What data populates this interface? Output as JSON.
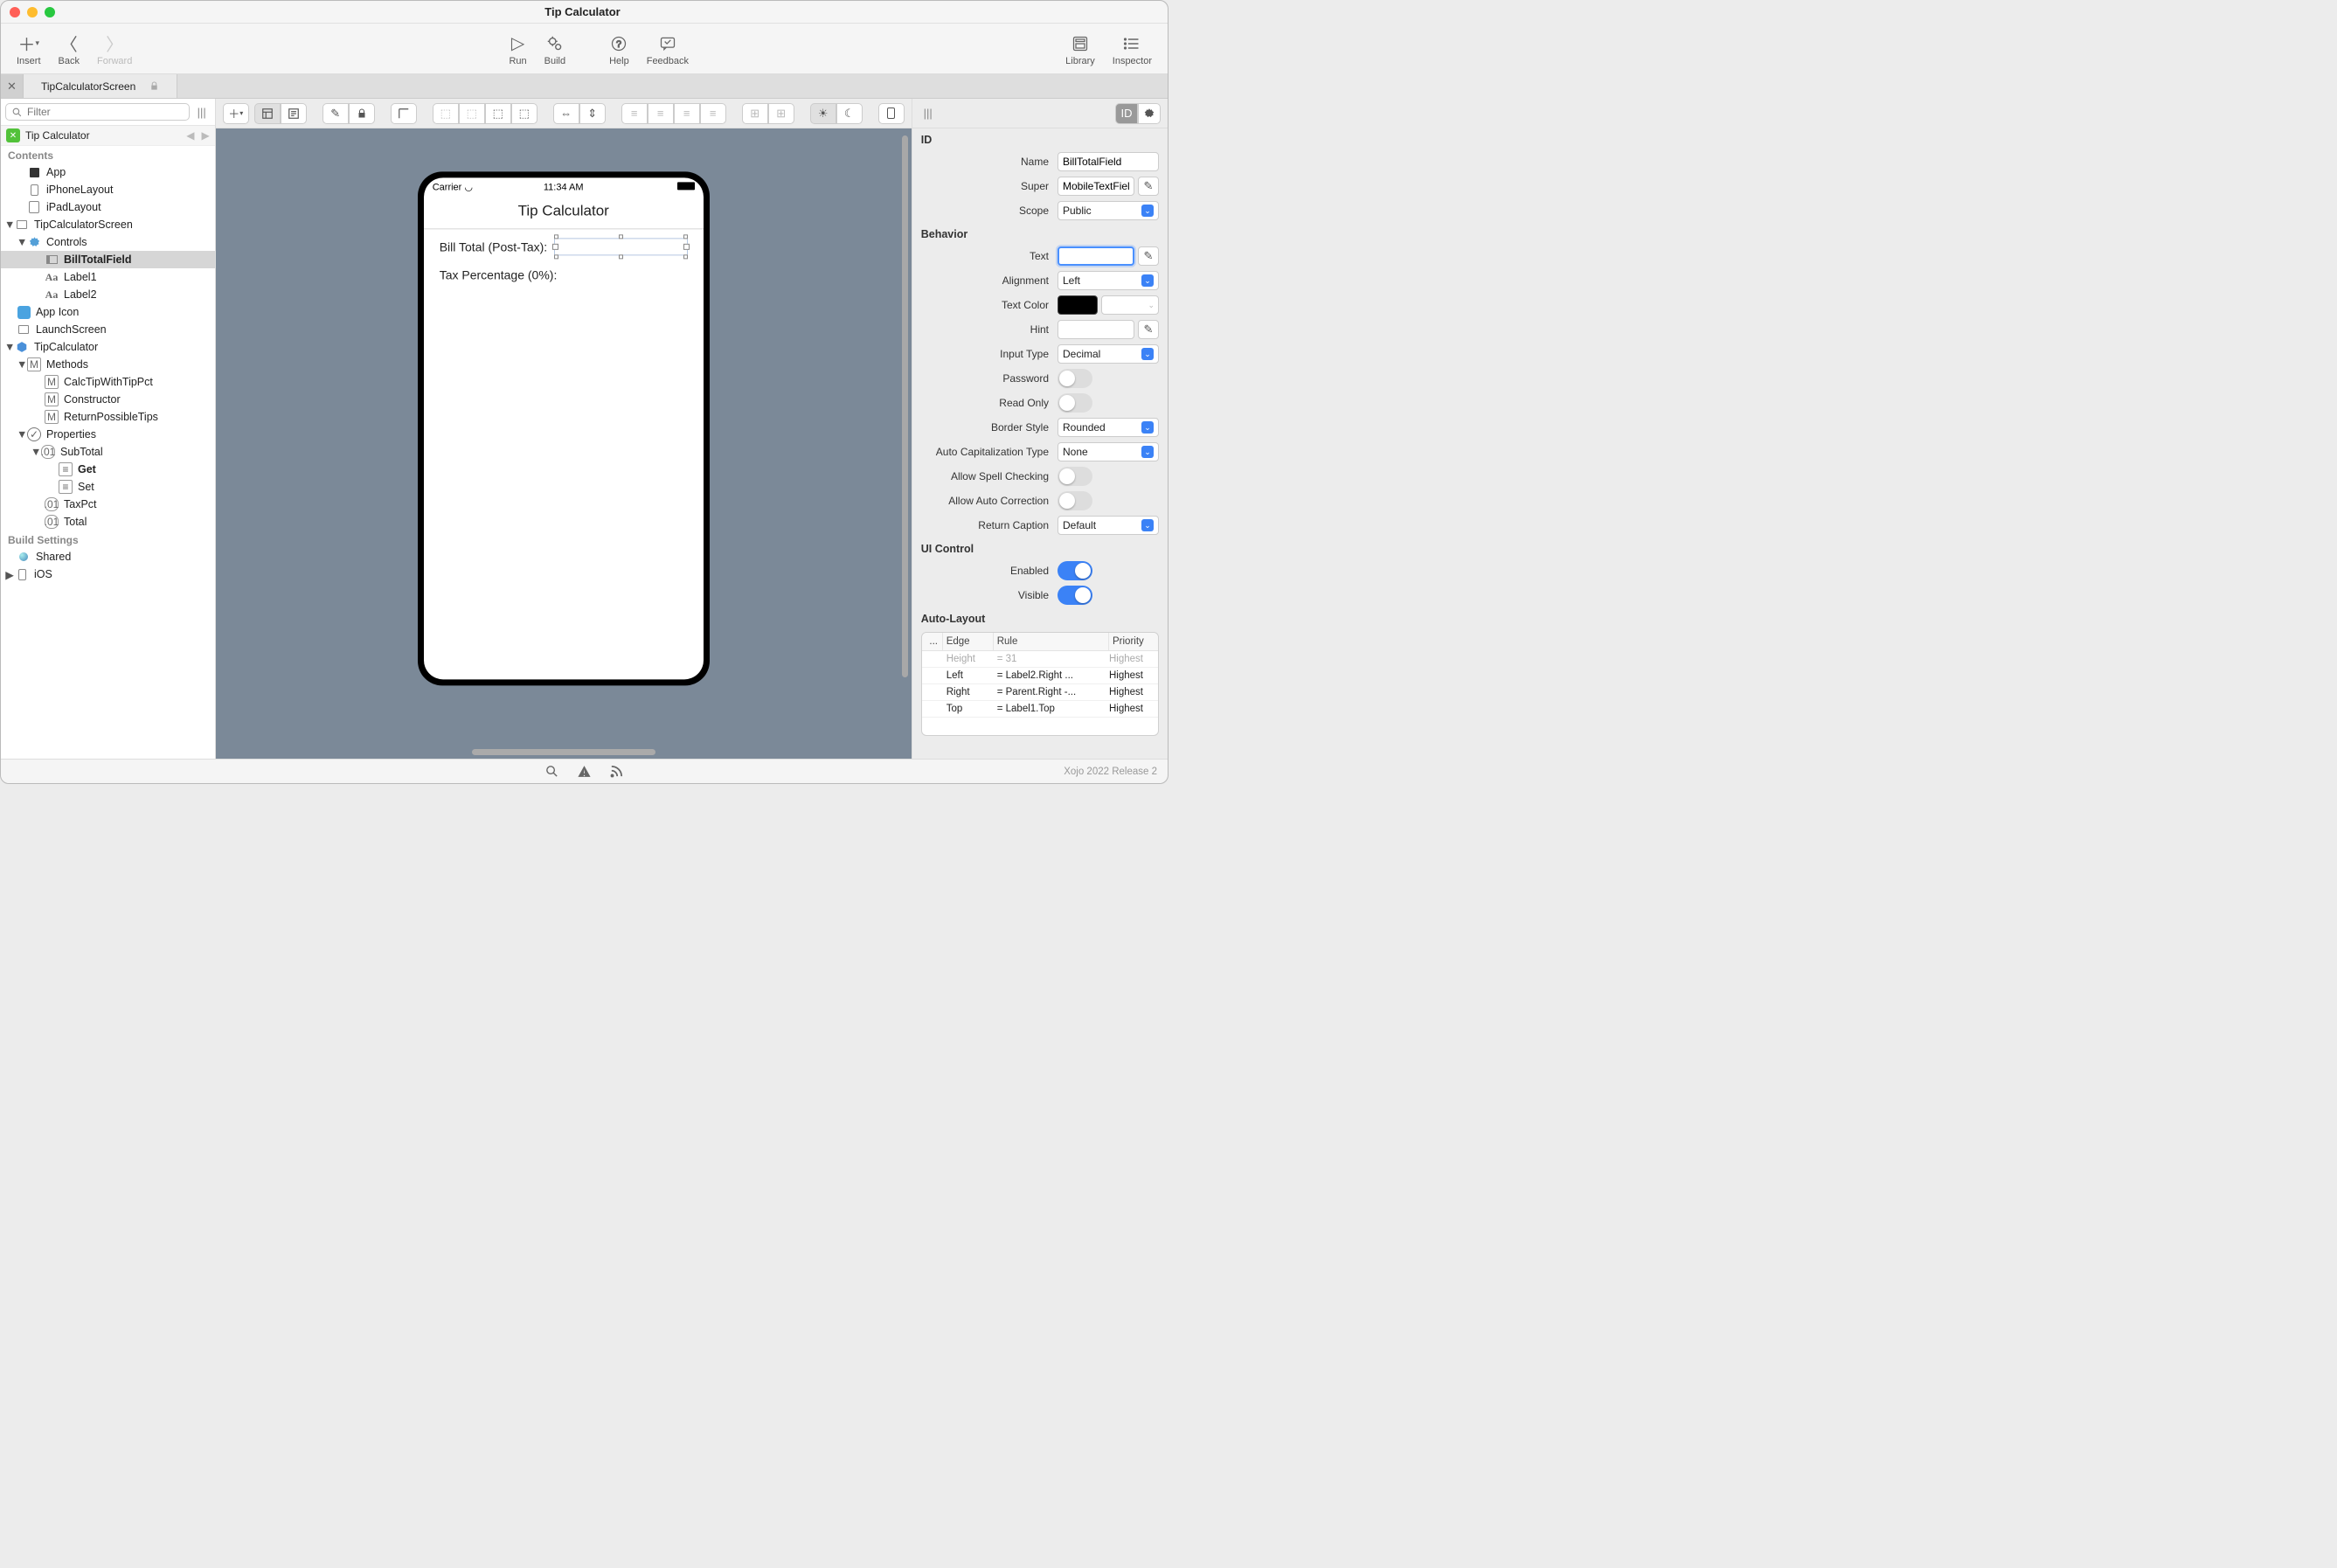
{
  "window": {
    "title": "Tip Calculator"
  },
  "toolbar": {
    "insert": "Insert",
    "back": "Back",
    "forward": "Forward",
    "run": "Run",
    "build": "Build",
    "help": "Help",
    "feedback": "Feedback",
    "library": "Library",
    "inspector": "Inspector"
  },
  "tab": {
    "label": "TipCalculatorScreen"
  },
  "navigator": {
    "filter_placeholder": "Filter",
    "project": "Tip Calculator",
    "contents_label": "Contents",
    "build_label": "Build Settings",
    "items": {
      "app": "App",
      "iphone": "iPhoneLayout",
      "ipad": "iPadLayout",
      "screen": "TipCalculatorScreen",
      "controls": "Controls",
      "billtotal": "BillTotalField",
      "label1": "Label1",
      "label2": "Label2",
      "appicon": "App Icon",
      "launch": "LaunchScreen",
      "tipcalc": "TipCalculator",
      "methods": "Methods",
      "calc": "CalcTipWithTipPct",
      "constructor": "Constructor",
      "returntips": "ReturnPossibleTips",
      "properties": "Properties",
      "subtotal": "SubTotal",
      "get": "Get",
      "set": "Set",
      "taxpct": "TaxPct",
      "total": "Total",
      "shared": "Shared",
      "ios": "iOS"
    }
  },
  "device": {
    "carrier": "Carrier",
    "time": "11:34 AM",
    "app_title": "Tip Calculator",
    "row1": "Bill Total (Post-Tax):",
    "row2": "Tax Percentage (0%):"
  },
  "inspector": {
    "section_id": "ID",
    "section_behavior": "Behavior",
    "section_ui": "UI Control",
    "section_al": "Auto-Layout",
    "name_label": "Name",
    "name_value": "BillTotalField",
    "super_label": "Super",
    "super_value": "MobileTextFiel",
    "scope_label": "Scope",
    "scope_value": "Public",
    "text_label": "Text",
    "text_value": "",
    "align_label": "Alignment",
    "align_value": "Left",
    "textcolor_label": "Text Color",
    "hint_label": "Hint",
    "hint_value": "",
    "input_label": "Input Type",
    "input_value": "Decimal",
    "password_label": "Password",
    "readonly_label": "Read Only",
    "border_label": "Border Style",
    "border_value": "Rounded",
    "autocap_label": "Auto Capitalization Type",
    "autocap_value": "None",
    "spell_label": "Allow Spell Checking",
    "autocorrect_label": "Allow Auto Correction",
    "returncap_label": "Return Caption",
    "returncap_value": "Default",
    "enabled_label": "Enabled",
    "visible_label": "Visible",
    "al_cols": {
      "c1": "...",
      "c2": "Edge",
      "c3": "Rule",
      "c4": "Priority"
    },
    "al_rows": [
      {
        "edge": "Height",
        "rule": "=  31",
        "priority": "Highest",
        "dim": true
      },
      {
        "edge": "Left",
        "rule": "= Label2.Right ...",
        "priority": "Highest"
      },
      {
        "edge": "Right",
        "rule": "= Parent.Right -...",
        "priority": "Highest"
      },
      {
        "edge": "Top",
        "rule": "= Label1.Top",
        "priority": "Highest"
      }
    ]
  },
  "footer": {
    "version": "Xojo 2022 Release 2"
  }
}
